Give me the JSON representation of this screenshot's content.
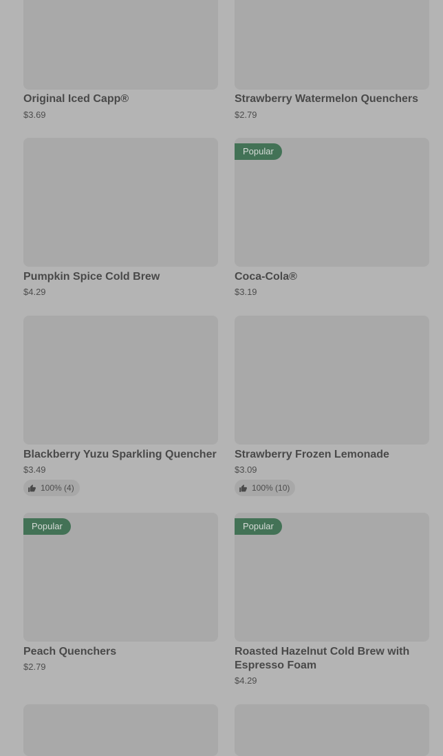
{
  "badges": {
    "popular": "Popular"
  },
  "items": [
    {
      "title": "Original Iced Capp®",
      "price": "$3.69"
    },
    {
      "title": "Strawberry Watermelon Quenchers",
      "price": "$2.79"
    },
    {
      "title": "Pumpkin Spice Cold Brew",
      "price": "$4.29"
    },
    {
      "title": "Coca-Cola®",
      "price": "$3.19",
      "badge": "Popular"
    },
    {
      "title": "Blackberry Yuzu Sparkling Quencher",
      "price": "$3.49",
      "rating": "100% (4)"
    },
    {
      "title": "Strawberry Frozen Lemonade",
      "price": "$3.09",
      "rating": "100% (10)"
    },
    {
      "title": "Peach Quenchers",
      "price": "$2.79",
      "badge": "Popular"
    },
    {
      "title": "Roasted Hazelnut Cold Brew with Espresso Foam",
      "price": "$4.29",
      "badge": "Popular"
    }
  ],
  "icons": {
    "rating": "thumbs-up-icon"
  }
}
